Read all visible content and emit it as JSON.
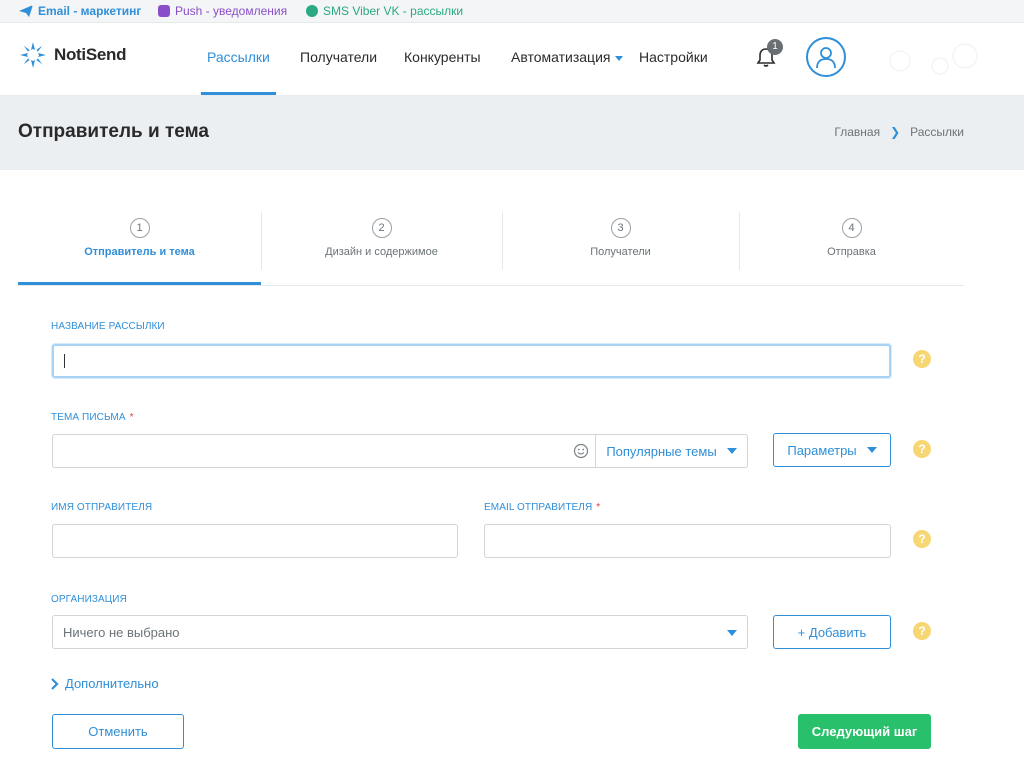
{
  "products": {
    "email": "Email - маркетинг",
    "push": "Push - уведомления",
    "sms": "SMS Viber VK - рассылки"
  },
  "header": {
    "logo": "NotiSend",
    "nav": {
      "mailings": "Рассылки",
      "recipients": "Получатели",
      "competitors": "Конкуренты",
      "automation": "Автоматизация",
      "settings": "Настройки"
    },
    "active_nav": "Рассылки",
    "notifications_count": "1"
  },
  "page": {
    "title": "Отправитель и тема",
    "breadcrumb": [
      "Главная",
      "Рассылки"
    ]
  },
  "steps": [
    {
      "num": "1",
      "label": "Отправитель и тема",
      "active": true
    },
    {
      "num": "2",
      "label": "Дизайн и содержимое",
      "active": false
    },
    {
      "num": "3",
      "label": "Получатели",
      "active": false
    },
    {
      "num": "4",
      "label": "Отправка",
      "active": false
    }
  ],
  "form": {
    "campaign_name": {
      "label": "НАЗВАНИЕ РАССЫЛКИ",
      "value": ""
    },
    "subject": {
      "label": "ТЕМА ПИСЬМА",
      "required_mark": "*",
      "value": "",
      "popular_label": "Популярные темы",
      "params_label": "Параметры"
    },
    "sender_name": {
      "label": "ИМЯ ОТПРАВИТЕЛЯ",
      "value": ""
    },
    "sender_email": {
      "label": "EMAIL ОТПРАВИТЕЛЯ",
      "required_mark": "*",
      "value": ""
    },
    "organization": {
      "label": "ОРГАНИЗАЦИЯ",
      "selected": "Ничего не выбрано",
      "add_label": "+ Добавить"
    },
    "help_glyph": "?",
    "more_label": "Дополнительно",
    "cancel_label": "Отменить",
    "next_label": "Следующий шаг"
  },
  "colors": {
    "accent": "#2f8fd8",
    "success": "#28c06b",
    "help": "#f7d774",
    "title_band": "#eceff1"
  }
}
